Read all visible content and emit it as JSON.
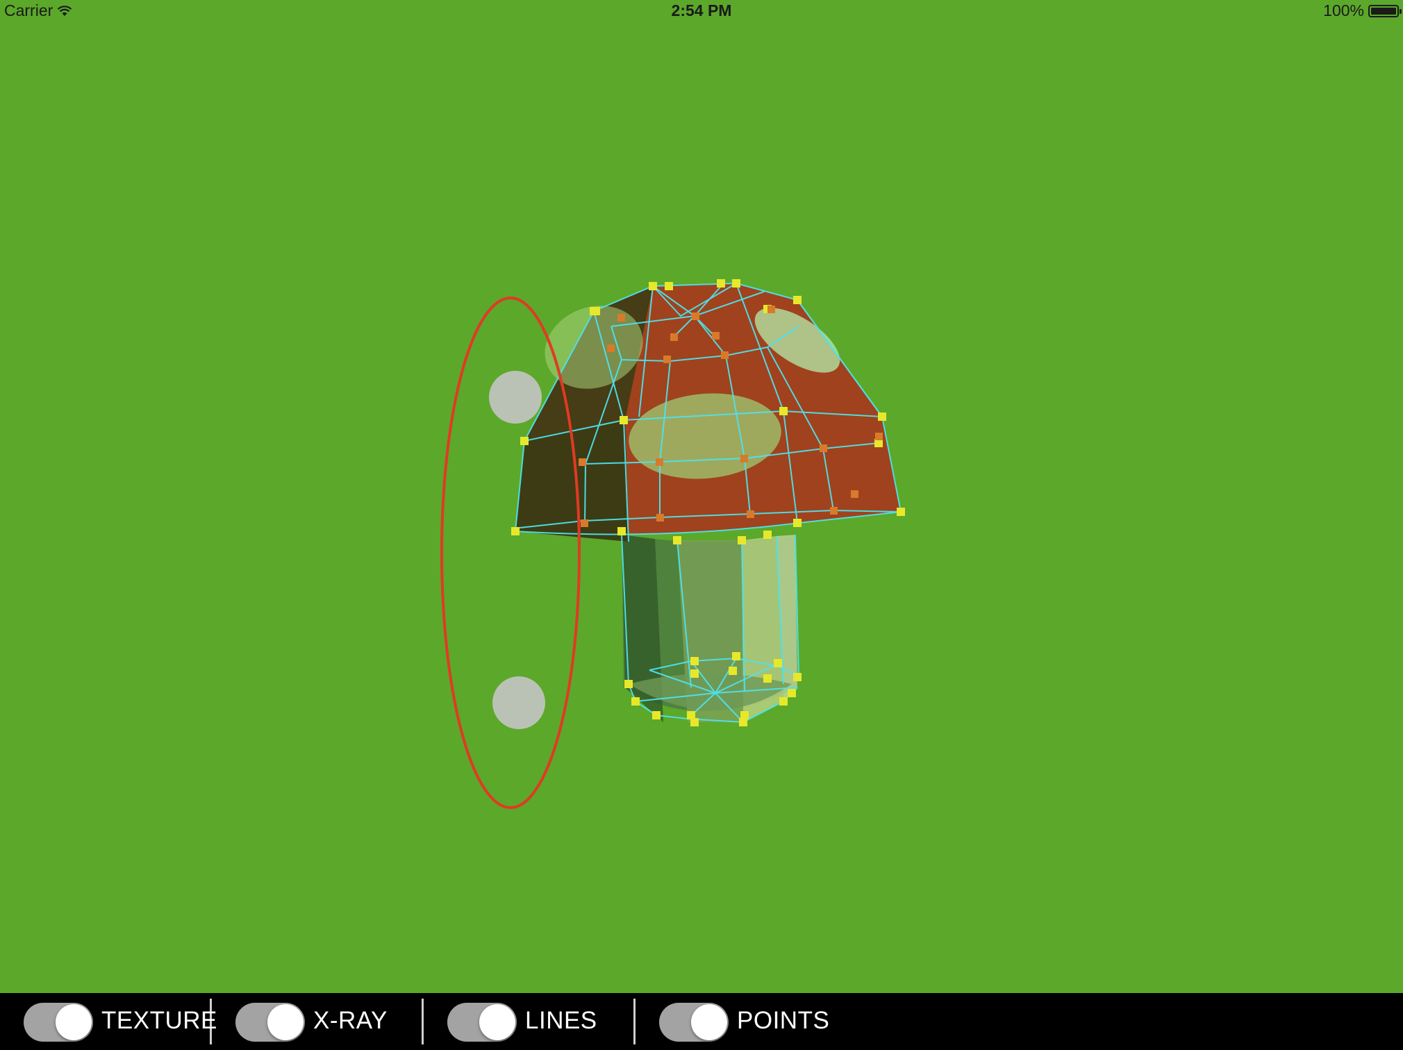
{
  "status_bar": {
    "carrier": "Carrier",
    "time": "2:54 PM",
    "battery": "100%",
    "battery_level": 1.0
  },
  "scene": {
    "background_color": "#5ca82a",
    "model": "mushroom",
    "render_modes": [
      "texture",
      "x-ray",
      "lines",
      "points"
    ],
    "cap_color": "#a0421d",
    "stem_color": "#4e7d3e",
    "wireframe_color": "#4de3ee",
    "vertex_color": "#e8e82a",
    "rotation_gizmo_color": "#e03a24",
    "gizmo_handle_color": "#c4c4c4"
  },
  "toolbar": {
    "toggles": [
      {
        "label": "TEXTURE",
        "on": true
      },
      {
        "label": "X-RAY",
        "on": true
      },
      {
        "label": "LINES",
        "on": true
      },
      {
        "label": "POINTS",
        "on": true
      }
    ]
  }
}
